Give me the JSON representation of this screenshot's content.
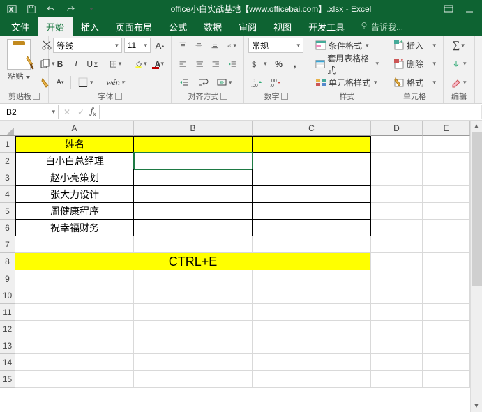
{
  "title": "office小白实战基地【www.officebai.com】.xlsx - Excel",
  "tabs": [
    "文件",
    "开始",
    "插入",
    "页面布局",
    "公式",
    "数据",
    "审阅",
    "视图",
    "开发工具"
  ],
  "tabs_active_index": 1,
  "tellme": "告诉我...",
  "clipboard": {
    "paste": "粘贴",
    "group": "剪贴板"
  },
  "font": {
    "name": "等线",
    "size": "11",
    "group": "字体"
  },
  "alignment": {
    "group": "对齐方式"
  },
  "number": {
    "format": "常规",
    "group": "数字"
  },
  "styles": {
    "cond": "条件格式",
    "table": "套用表格格式",
    "cell": "单元格样式",
    "group": "样式"
  },
  "cellsgrp": {
    "insert": "插入",
    "delete": "删除",
    "format": "格式",
    "group": "单元格"
  },
  "editing": {
    "group": "编辑"
  },
  "namebox": "B2",
  "columns": [
    {
      "l": "A",
      "w": 170
    },
    {
      "l": "B",
      "w": 170
    },
    {
      "l": "C",
      "w": 170
    },
    {
      "l": "D",
      "w": 74
    },
    {
      "l": "E",
      "w": 68
    }
  ],
  "row_h_tall": 25,
  "row_h_norm": 24,
  "rows": 15,
  "cells": {
    "A1": {
      "v": "姓名",
      "hl": true
    },
    "B1": {
      "v": "",
      "hl": true
    },
    "C1": {
      "v": "",
      "hl": true
    },
    "A2": {
      "v": "白小白总经理"
    },
    "A3": {
      "v": "赵小亮策划"
    },
    "A4": {
      "v": "张大力设计"
    },
    "A5": {
      "v": "周健康程序"
    },
    "A6": {
      "v": "祝幸福财务"
    }
  },
  "merged_row8": {
    "text": "CTRL+E"
  },
  "active_cell": "B2",
  "chart_data": {
    "type": "table",
    "columns": [
      "姓名"
    ],
    "rows": [
      "白小白总经理",
      "赵小亮策划",
      "张大力设计",
      "周健康程序",
      "祝幸福财务"
    ],
    "annotation": "CTRL+E"
  }
}
